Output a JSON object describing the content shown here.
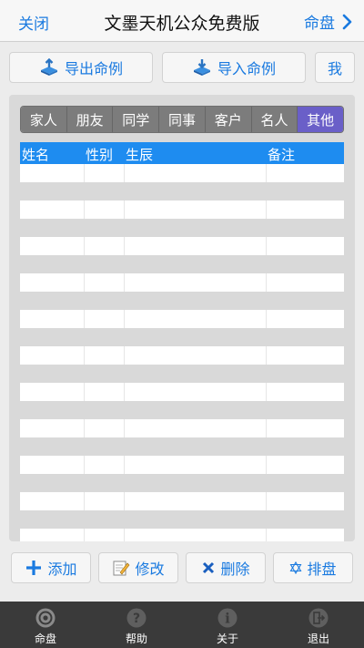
{
  "nav": {
    "left": "关闭",
    "title": "文墨天机公众免费版",
    "right": "命盘",
    "right_icon": "chevron-right-icon"
  },
  "topbuttons": {
    "export": "导出命例",
    "import": "导入命例",
    "me": "我"
  },
  "tabs": [
    {
      "label": "家人"
    },
    {
      "label": "朋友"
    },
    {
      "label": "同学"
    },
    {
      "label": "同事"
    },
    {
      "label": "客户"
    },
    {
      "label": "名人"
    },
    {
      "label": "其他",
      "active": true
    }
  ],
  "table": {
    "columns": [
      "姓名",
      "性别",
      "生辰",
      "备注"
    ],
    "rows": []
  },
  "actions": {
    "add": "添加",
    "edit": "修改",
    "delete": "删除",
    "layout": "排盘"
  },
  "tabbar": [
    {
      "label": "命盘",
      "icon": "target-icon"
    },
    {
      "label": "帮助",
      "icon": "help-icon"
    },
    {
      "label": "关于",
      "icon": "info-icon"
    },
    {
      "label": "退出",
      "icon": "exit-icon"
    }
  ],
  "colors": {
    "accent": "#1a7ae0",
    "header": "#1e8cf0",
    "active_tab": "#6a5fc8",
    "tabbar": "#3a3a3a"
  }
}
